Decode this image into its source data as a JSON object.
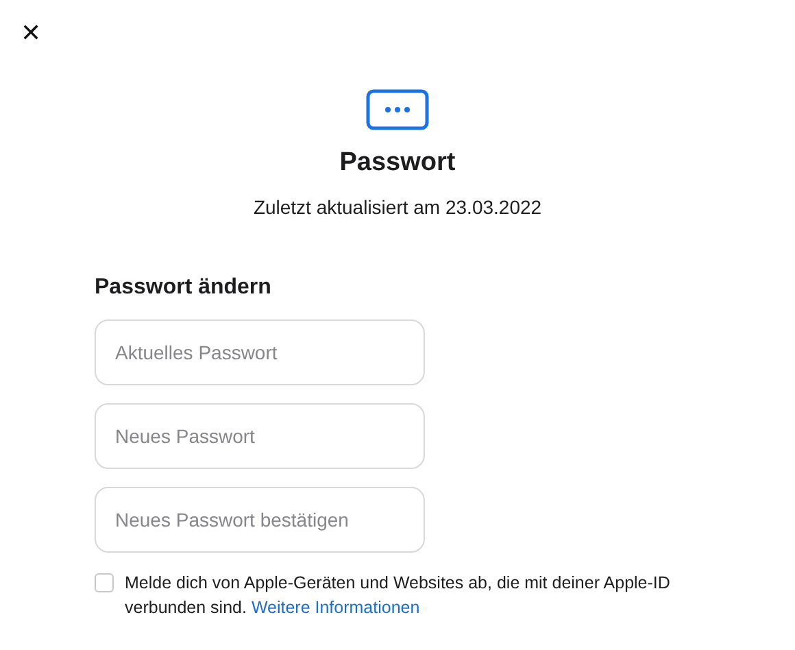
{
  "close_button": {
    "label": "✕"
  },
  "header": {
    "title": "Passwort",
    "subtitle": "Zuletzt aktualisiert am 23.03.2022"
  },
  "section": {
    "heading": "Passwort ändern"
  },
  "fields": [
    {
      "placeholder": "Aktuelles Passwort"
    },
    {
      "placeholder": "Neues Passwort"
    },
    {
      "placeholder": "Neues Passwort bestätigen"
    }
  ],
  "sign_out_option": {
    "checked": false,
    "text": "Melde dich von Apple-Geräten und Websites ab, die mit deiner Apple-ID verbunden sind.",
    "link": "Weitere Informationen"
  }
}
